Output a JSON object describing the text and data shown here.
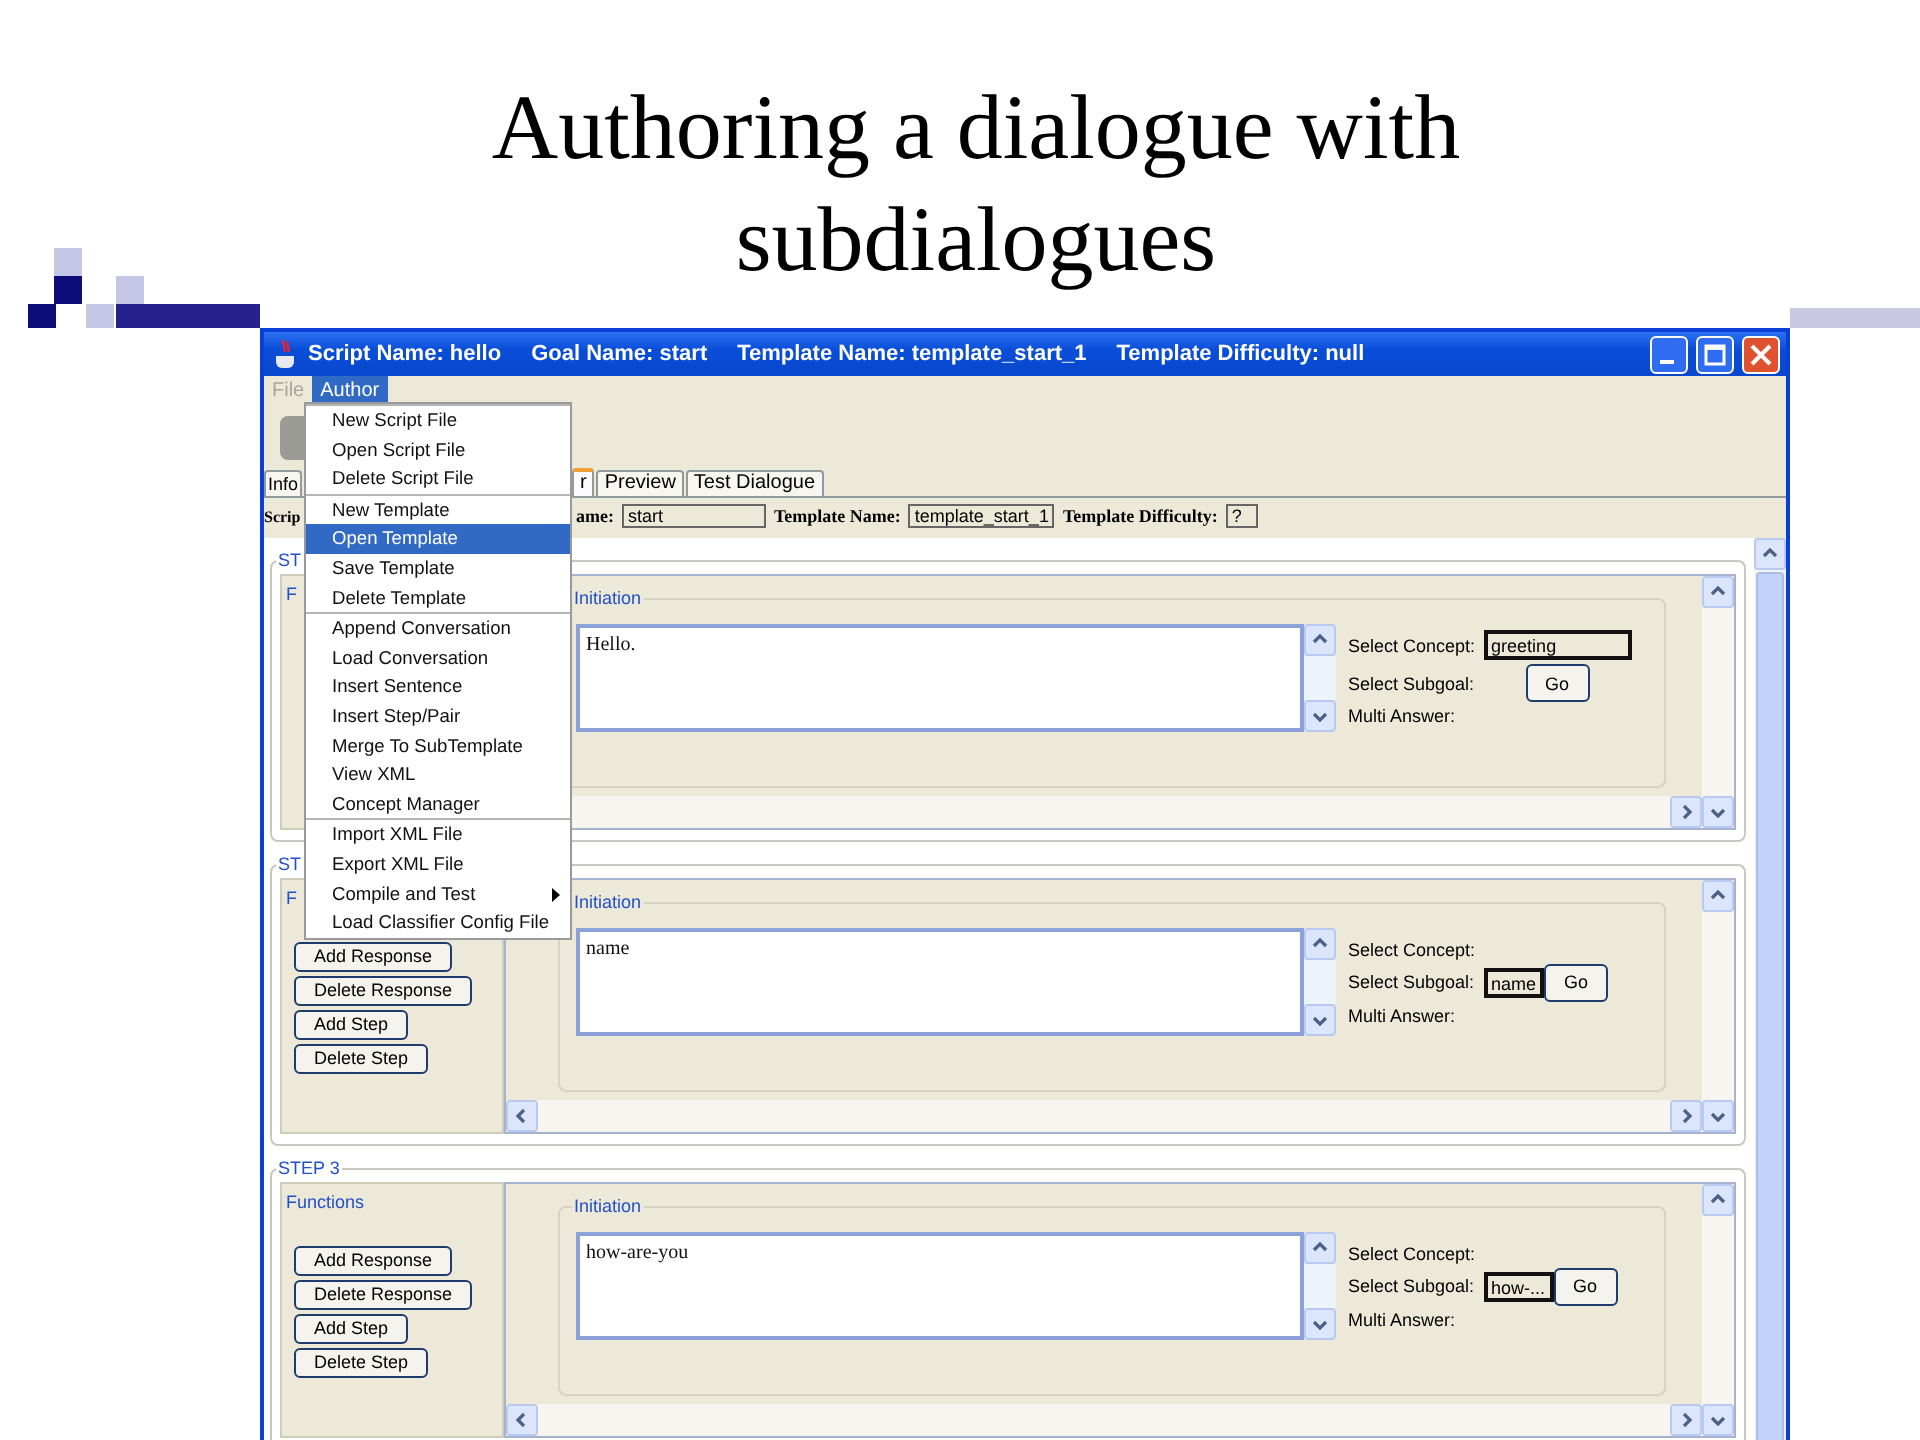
{
  "slide": {
    "title": "Authoring a dialogue with subdialogues"
  },
  "window": {
    "title_parts": [
      "Script Name: hello",
      "Goal Name: start",
      "Template Name: template_start_1",
      "Template Difficulty: null"
    ]
  },
  "menubar": [
    {
      "label": "File",
      "selected": false
    },
    {
      "label": "Author",
      "selected": true
    }
  ],
  "menu": {
    "groups": [
      [
        {
          "label": "New Script File",
          "selected": false,
          "submenu": false
        },
        {
          "label": "Open Script File",
          "selected": false,
          "submenu": false
        },
        {
          "label": "Delete Script File",
          "selected": false,
          "submenu": false
        }
      ],
      [
        {
          "label": "New Template",
          "selected": false,
          "submenu": false
        },
        {
          "label": "Open Template",
          "selected": true,
          "submenu": false
        },
        {
          "label": "Save Template",
          "selected": false,
          "submenu": false
        },
        {
          "label": "Delete Template",
          "selected": false,
          "submenu": false
        }
      ],
      [
        {
          "label": "Append Conversation",
          "selected": false,
          "submenu": false
        },
        {
          "label": "Load Conversation",
          "selected": false,
          "submenu": false
        },
        {
          "label": "Insert Sentence",
          "selected": false,
          "submenu": false
        },
        {
          "label": "Insert Step/Pair",
          "selected": false,
          "submenu": false
        },
        {
          "label": "Merge To SubTemplate",
          "selected": false,
          "submenu": false
        },
        {
          "label": "View XML",
          "selected": false,
          "submenu": false
        },
        {
          "label": "Concept Manager",
          "selected": false,
          "submenu": false
        }
      ],
      [
        {
          "label": "Import XML File",
          "selected": false,
          "submenu": false
        },
        {
          "label": "Export XML File",
          "selected": false,
          "submenu": false
        },
        {
          "label": "Compile and Test",
          "selected": false,
          "submenu": true
        },
        {
          "label": "Load Classifier Config File",
          "selected": false,
          "submenu": false
        }
      ]
    ]
  },
  "tabs": [
    {
      "label": "Info",
      "selected": false
    },
    {
      "label": "r",
      "selected": true
    },
    {
      "label": "Preview",
      "selected": false
    },
    {
      "label": "Test Dialogue",
      "selected": false
    }
  ],
  "header": [
    {
      "label": "Scrip"
    },
    {
      "label": "ame:",
      "value": "start"
    },
    {
      "label": "Template Name:",
      "value": "template_start_1"
    },
    {
      "label": "Template Difficulty:",
      "value": "?"
    }
  ],
  "steps": [
    {
      "title": "ST",
      "functions_title": "F",
      "initiation_title": "Initiation",
      "text": "Hello.",
      "concept_label": "Select Concept:",
      "concept": "greeting",
      "subgoal_label": "Select Subgoal:",
      "go": "Go",
      "multi_label": "Multi Answer:"
    },
    {
      "title": "ST",
      "functions_title": "F",
      "buttons": [
        "Add Response",
        "Delete Response",
        "Add Step",
        "Delete Step"
      ],
      "initiation_title": "Initiation",
      "text": "name",
      "concept_label": "Select Concept:",
      "subgoal_label": "Select Subgoal:",
      "subgoal": "name",
      "go": "Go",
      "multi_label": "Multi Answer:"
    },
    {
      "title": "STEP 3",
      "functions_title": "Functions",
      "buttons": [
        "Add Response",
        "Delete Response",
        "Add Step",
        "Delete Step"
      ],
      "initiation_title": "Initiation",
      "text": "how-are-you",
      "concept_label": "Select Concept:",
      "subgoal_label": "Select Subgoal:",
      "subgoal": "how-...",
      "go": "Go",
      "multi_label": "Multi Answer:"
    }
  ]
}
